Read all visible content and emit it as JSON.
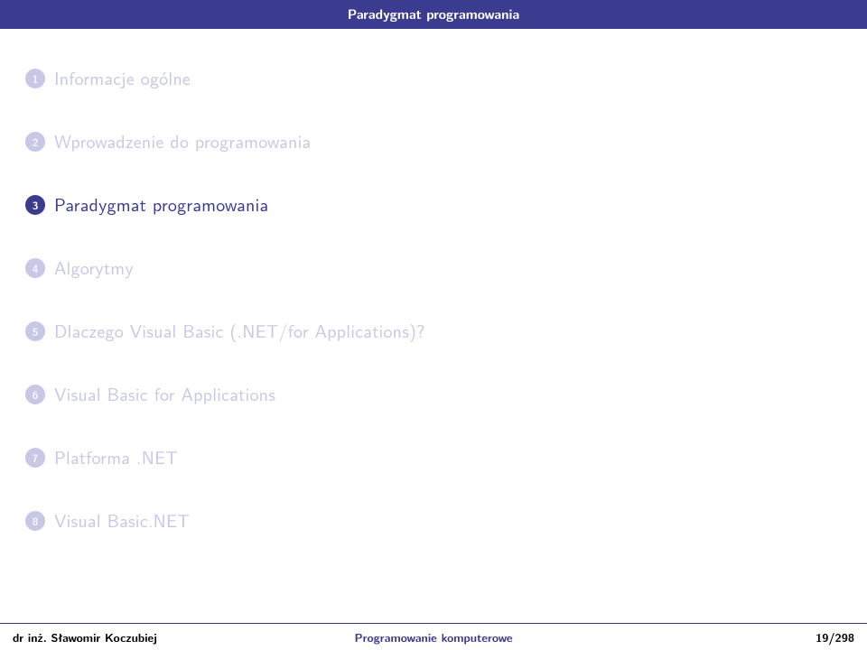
{
  "header": {
    "title": "Paradygmat programowania"
  },
  "toc": {
    "items": [
      {
        "num": "1",
        "label": "Informacje ogólne",
        "active": false
      },
      {
        "num": "2",
        "label": "Wprowadzenie do programowania",
        "active": false
      },
      {
        "num": "3",
        "label": "Paradygmat programowania",
        "active": true
      },
      {
        "num": "4",
        "label": "Algorytmy",
        "active": false
      },
      {
        "num": "5",
        "label": "Dlaczego Visual Basic (.NET/for Applications)?",
        "active": false
      },
      {
        "num": "6",
        "label": "Visual Basic for Applications",
        "active": false
      },
      {
        "num": "7",
        "label": "Platforma .NET",
        "active": false
      },
      {
        "num": "8",
        "label": "Visual Basic.NET",
        "active": false
      }
    ]
  },
  "footer": {
    "author": "dr inż. Sławomir Koczubiej",
    "title": "Programowanie komputerowe",
    "page": "19/298"
  }
}
